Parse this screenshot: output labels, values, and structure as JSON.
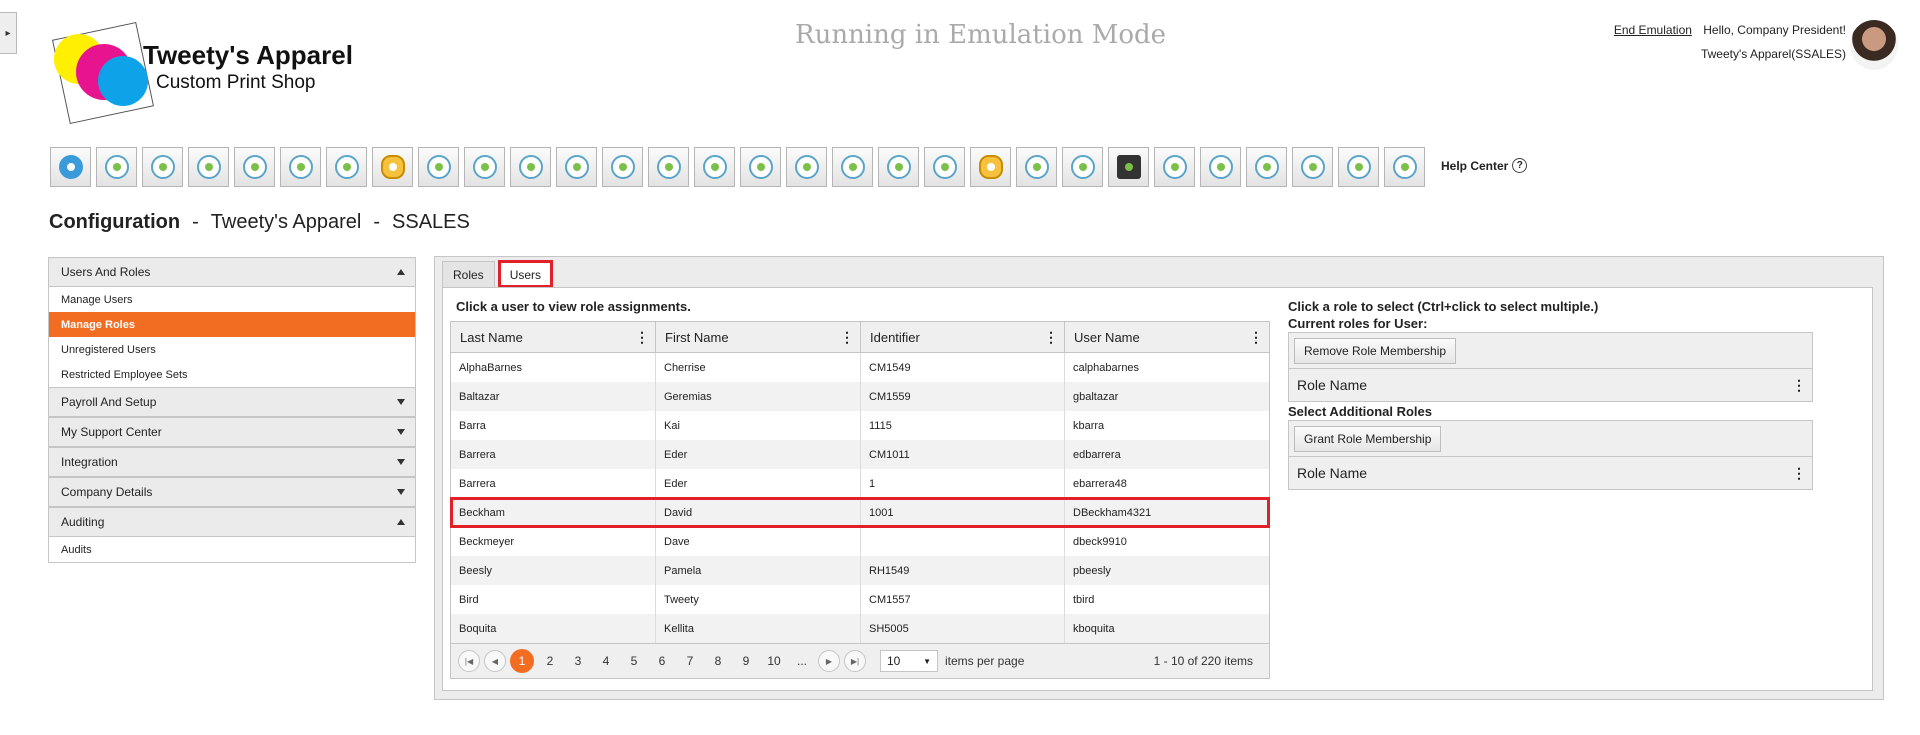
{
  "sidebar_toggle": "▸",
  "brand": {
    "title": "Tweety's Apparel",
    "subtitle": "Custom Print Shop"
  },
  "emulation_banner": "Running in Emulation Mode",
  "user": {
    "end_emulation": "End Emulation",
    "greeting": "Hello, Company President!",
    "company": "Tweety's Apparel(SSALES)"
  },
  "toolbar_icons": [
    "home-icon",
    "people-icon",
    "people-gear-icon",
    "dashboard-icon",
    "group-icon",
    "org-chart-icon",
    "report-icon",
    "money-bag-icon",
    "search-people-icon",
    "target-icon",
    "crosshair-icon",
    "growth-icon",
    "target-gear-icon",
    "transfer-icon",
    "handshake-icon",
    "shield-icon",
    "award-icon",
    "transfer-down-icon",
    "person-remove-icon",
    "fingerprint-icon",
    "money-bag-icon",
    "handshake-icon",
    "team-icon",
    "clipboard-add-icon",
    "shield-icon",
    "search-doc-icon",
    "gift-icon",
    "document-icon",
    "meeting-icon",
    "certificate-icon"
  ],
  "help_center": {
    "label": "Help Center",
    "icon": "?"
  },
  "page_title": {
    "section": "Configuration",
    "sep": "-",
    "company": "Tweety's Apparel",
    "code": "SSALES"
  },
  "nav": {
    "groups": [
      {
        "label": "Users And Roles",
        "expanded": true,
        "items": [
          "Manage Users",
          "Manage Roles",
          "Unregistered Users",
          "Restricted Employee Sets"
        ],
        "active": 1
      },
      {
        "label": "Payroll And Setup",
        "expanded": false
      },
      {
        "label": "My Support Center",
        "expanded": false
      },
      {
        "label": "Integration",
        "expanded": false
      },
      {
        "label": "Company Details",
        "expanded": false
      },
      {
        "label": "Auditing",
        "expanded": true,
        "items": [
          "Audits"
        ]
      }
    ]
  },
  "tabs": [
    "Roles",
    "Users"
  ],
  "left_hint": "Click a user to view role assignments.",
  "grid": {
    "columns": [
      "Last Name",
      "First Name",
      "Identifier",
      "User Name"
    ],
    "rows": [
      [
        "AlphaBarnes",
        "Cherrise",
        "CM1549",
        "calphabarnes"
      ],
      [
        "Baltazar",
        "Geremias",
        "CM1559",
        "gbaltazar"
      ],
      [
        "Barra",
        "Kai",
        "1115",
        "kbarra"
      ],
      [
        "Barrera",
        "Eder",
        "CM1011",
        "edbarrera"
      ],
      [
        "Barrera",
        "Eder",
        "1",
        "ebarrera48"
      ],
      [
        "Beckham",
        "David",
        "1001",
        "DBeckham4321"
      ],
      [
        "Beckmeyer",
        "Dave",
        "",
        "dbeck9910"
      ],
      [
        "Beesly",
        "Pamela",
        "RH1549",
        "pbeesly"
      ],
      [
        "Bird",
        "Tweety",
        "CM1557",
        "tbird"
      ],
      [
        "Boquita",
        "Kellita",
        "SH5005",
        "kboquita"
      ]
    ],
    "selected_row": 5
  },
  "pager": {
    "pages": [
      "1",
      "2",
      "3",
      "4",
      "5",
      "6",
      "7",
      "8",
      "9",
      "10",
      "..."
    ],
    "per_page": "10",
    "per_page_label": "items per page",
    "info": "1 - 10 of 220 items"
  },
  "right": {
    "hint": "Click a role to select (Ctrl+click to select multiple.)",
    "current_label": "Current roles for User:",
    "remove_button": "Remove Role Membership",
    "role_col_1": "Role Name",
    "additional_label": "Select Additional Roles",
    "grant_button": "Grant Role Membership",
    "role_col_2": "Role Name"
  },
  "colors": {
    "accent": "#f26d21",
    "highlight": "#e0212a"
  }
}
